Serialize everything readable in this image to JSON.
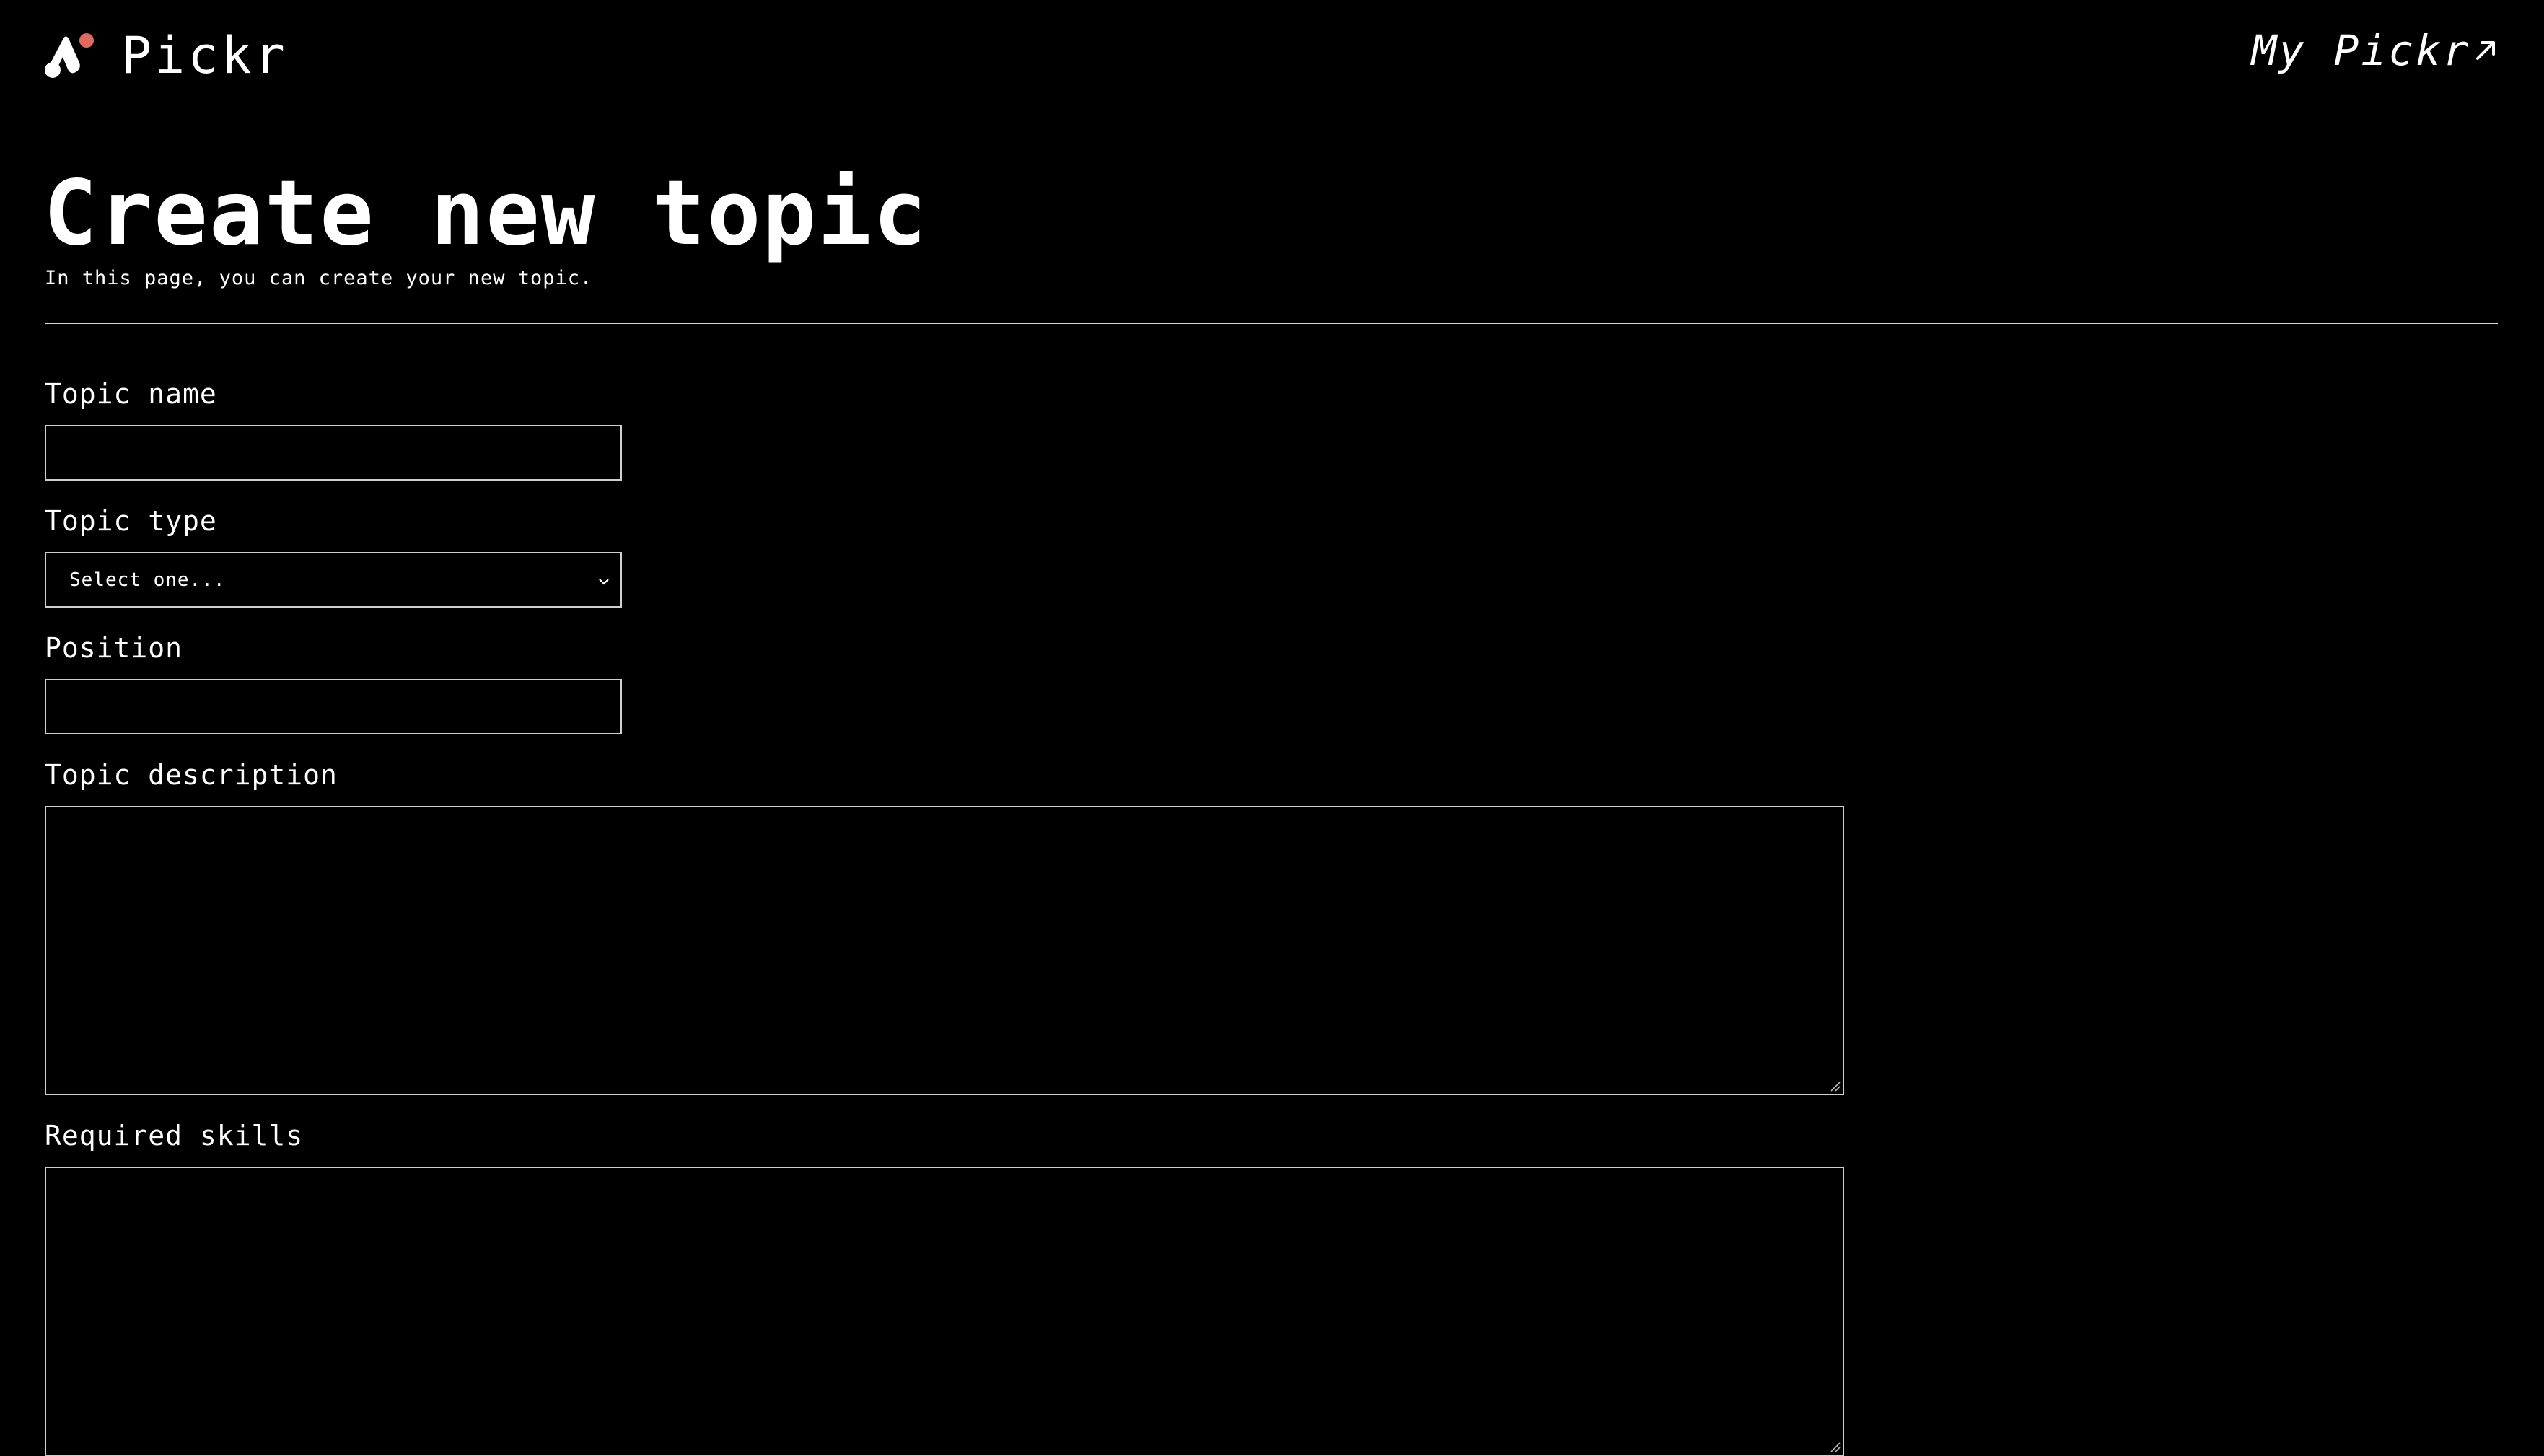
{
  "header": {
    "brand": "Pickr",
    "my_link": "My Pickr",
    "logo_dot_color": "#e06a5e"
  },
  "page": {
    "title": "Create new topic",
    "subtitle": "In this page, you can create your new topic."
  },
  "form": {
    "topic_name_label": "Topic name",
    "topic_name_value": "",
    "topic_type_label": "Topic type",
    "topic_type_selected": "Select one...",
    "position_label": "Position",
    "position_value": "",
    "description_label": "Topic description",
    "description_value": "",
    "skills_label": "Required skills",
    "skills_value": ""
  }
}
